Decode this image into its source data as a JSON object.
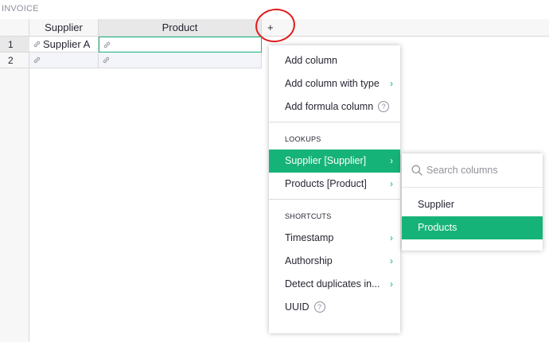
{
  "section": {
    "title": "INVOICE"
  },
  "columns": {
    "supplier": "Supplier",
    "product": "Product",
    "add": "+"
  },
  "rows": [
    {
      "num": "1",
      "supplier": "Supplier A",
      "product": ""
    },
    {
      "num": "2",
      "supplier": "",
      "product": ""
    }
  ],
  "menu": {
    "add_column": "Add column",
    "add_column_with_type": "Add column with type",
    "add_formula_column": "Add formula column",
    "help": "?",
    "lookups_heading": "LOOKUPS",
    "lookup_supplier": "Supplier [Supplier]",
    "lookup_products": "Products [Product]",
    "shortcuts_heading": "SHORTCUTS",
    "timestamp": "Timestamp",
    "authorship": "Authorship",
    "detect_duplicates": "Detect duplicates in...",
    "uuid": "UUID"
  },
  "submenu": {
    "search_placeholder": "Search columns",
    "items": [
      "Supplier",
      "Products"
    ]
  },
  "colors": {
    "accent": "#16b378",
    "annotation": "#e21b1b"
  }
}
